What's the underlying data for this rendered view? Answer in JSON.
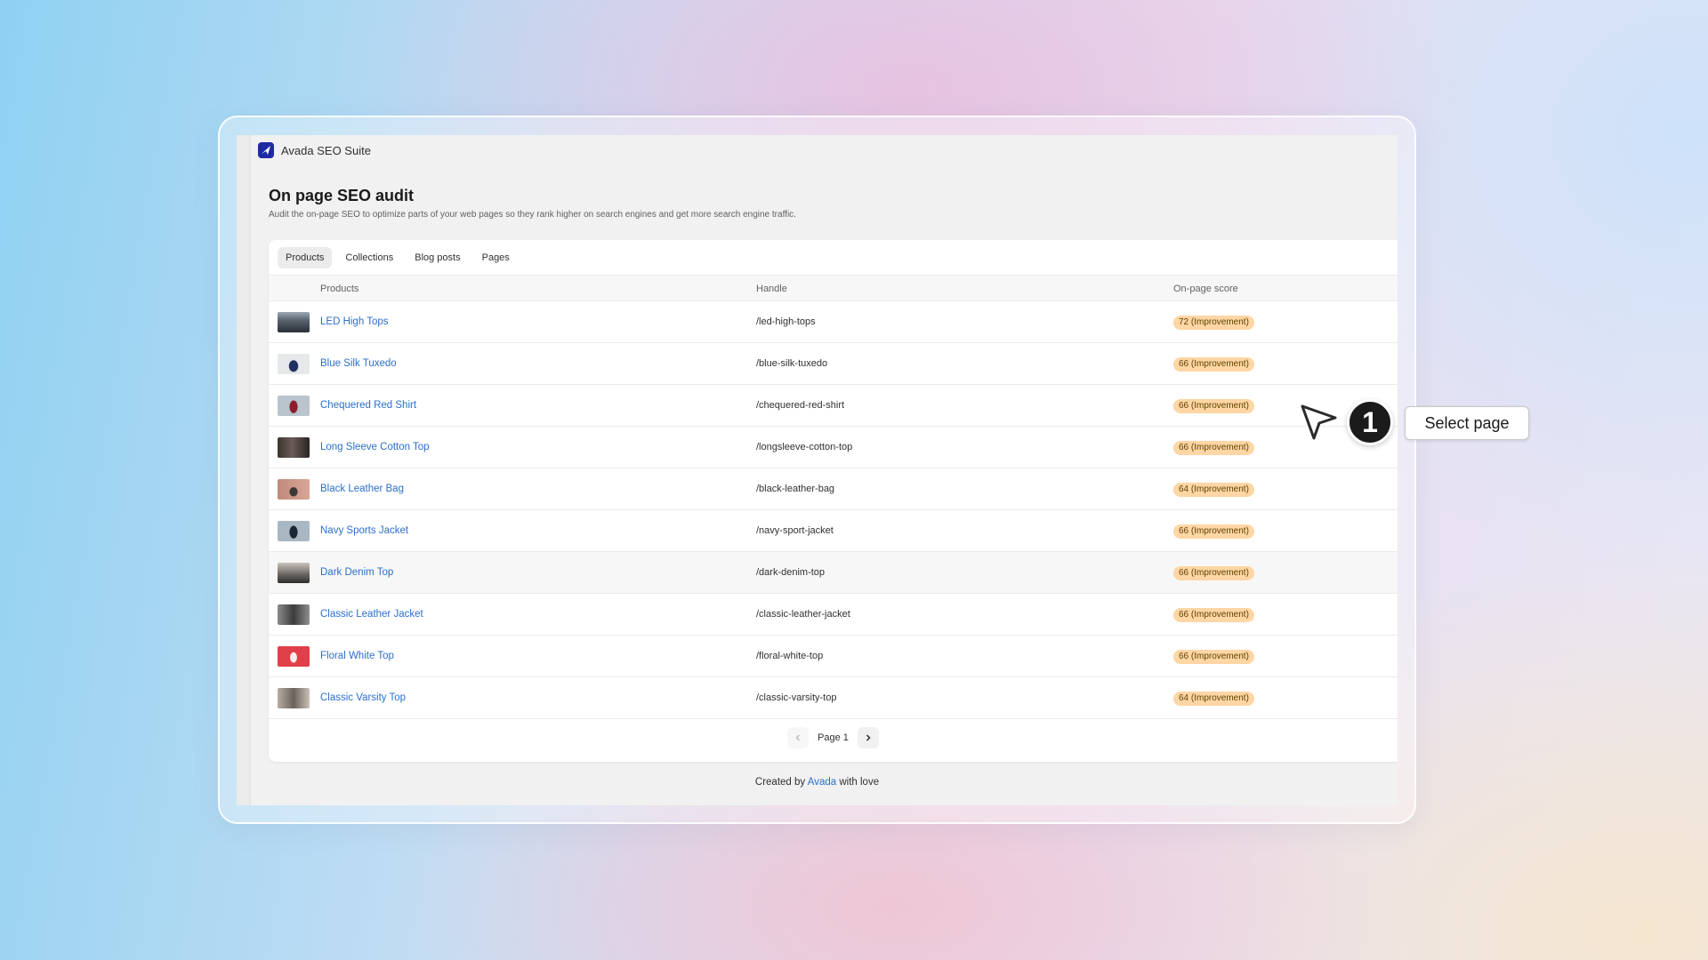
{
  "app": {
    "title": "Avada SEO Suite",
    "logo_icon": "avada-logo-icon"
  },
  "page": {
    "title": "On page SEO audit",
    "description": "Audit the on-page SEO to optimize parts of your web pages so they rank higher on search engines and get more search engine traffic."
  },
  "tabs": [
    {
      "label": "Products",
      "active": true
    },
    {
      "label": "Collections",
      "active": false
    },
    {
      "label": "Blog posts",
      "active": false
    },
    {
      "label": "Pages",
      "active": false
    }
  ],
  "table": {
    "columns": [
      "Products",
      "Handle",
      "On-page score"
    ],
    "rows": [
      {
        "name": "LED High Tops",
        "handle": "/led-high-tops",
        "score": "72 (Improvement)"
      },
      {
        "name": "Blue Silk Tuxedo",
        "handle": "/blue-silk-tuxedo",
        "score": "66 (Improvement)"
      },
      {
        "name": "Chequered Red Shirt",
        "handle": "/chequered-red-shirt",
        "score": "66 (Improvement)"
      },
      {
        "name": "Long Sleeve Cotton Top",
        "handle": "/longsleeve-cotton-top",
        "score": "66 (Improvement)"
      },
      {
        "name": "Black Leather Bag",
        "handle": "/black-leather-bag",
        "score": "64 (Improvement)"
      },
      {
        "name": "Navy Sports Jacket",
        "handle": "/navy-sport-jacket",
        "score": "66 (Improvement)"
      },
      {
        "name": "Dark Denim Top",
        "handle": "/dark-denim-top",
        "score": "66 (Improvement)"
      },
      {
        "name": "Classic Leather Jacket",
        "handle": "/classic-leather-jacket",
        "score": "66 (Improvement)"
      },
      {
        "name": "Floral White Top",
        "handle": "/floral-white-top",
        "score": "66 (Improvement)"
      },
      {
        "name": "Classic Varsity Top",
        "handle": "/classic-varsity-top",
        "score": "64 (Improvement)"
      }
    ]
  },
  "pagination": {
    "label": "Page 1",
    "prev_icon": "chevron-left-icon",
    "next_icon": "chevron-right-icon"
  },
  "footer": {
    "prefix": "Created by",
    "link": "Avada",
    "suffix": "with love"
  },
  "annotation": {
    "step": "1",
    "callout": "Select page",
    "pointer_icon": "cursor-arrow-icon"
  },
  "colors": {
    "link": "#2c6ecb",
    "badge_bg": "#ffd6a4",
    "badge_text": "#5e4200",
    "logo": "#1f2aa5",
    "step_badge": "#1b1b1b"
  }
}
